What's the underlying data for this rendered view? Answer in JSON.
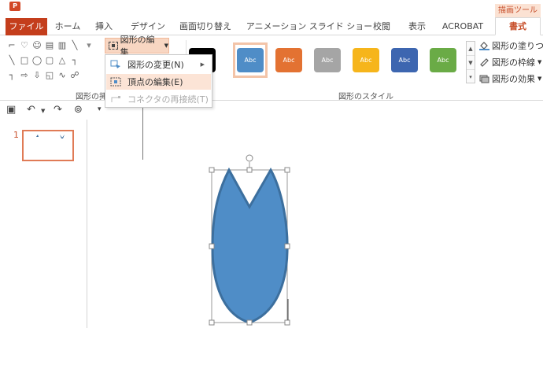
{
  "app": {
    "icon_glyph": "P"
  },
  "contextual_tab_group": "描画ツール",
  "tabs": [
    {
      "label": "ファイル",
      "kind": "file"
    },
    {
      "label": "ホーム",
      "kind": "normal"
    },
    {
      "label": "挿入",
      "kind": "normal"
    },
    {
      "label": "デザイン",
      "kind": "normal"
    },
    {
      "label": "画面切り替え",
      "kind": "normal"
    },
    {
      "label": "アニメーション",
      "kind": "normal"
    },
    {
      "label": "スライド ショー",
      "kind": "normal"
    },
    {
      "label": "校閲",
      "kind": "normal"
    },
    {
      "label": "表示",
      "kind": "normal"
    },
    {
      "label": "ACROBAT",
      "kind": "normal"
    },
    {
      "label": "書式",
      "kind": "active"
    }
  ],
  "ribbon": {
    "edit_shape_label": "図形の編集",
    "insert_shapes_group_label": "図形の挿",
    "shape_styles_group_label": "図形のスタイル",
    "style_swatch_text": "Abc",
    "style_swatches": [
      {
        "color": "#000000",
        "text": "bc"
      },
      {
        "color": "#4f8dc7",
        "text": "Abc"
      },
      {
        "color": "#e37232",
        "text": "Abc"
      },
      {
        "color": "#a5a5a5",
        "text": "Abc"
      },
      {
        "color": "#f6b51b",
        "text": "Abc"
      },
      {
        "color": "#3d66b0",
        "text": "Abc"
      },
      {
        "color": "#6aab46",
        "text": "Abc"
      }
    ],
    "format_commands": {
      "fill": "図形の塗りつぶ",
      "outline": "図形の枠線",
      "effects": "図形の効果"
    }
  },
  "edit_shape_menu": {
    "change_shape": "図形の変更(N)",
    "edit_points": "頂点の編集(E)",
    "reroute_connectors": "コネクタの再接続(T)"
  },
  "slides": {
    "current_number": "1"
  },
  "colors": {
    "accent": "#c43e1c",
    "shape_fill": "#4f8dc7",
    "shape_stroke": "#3c6f9e",
    "highlight": "#fce4d6"
  }
}
